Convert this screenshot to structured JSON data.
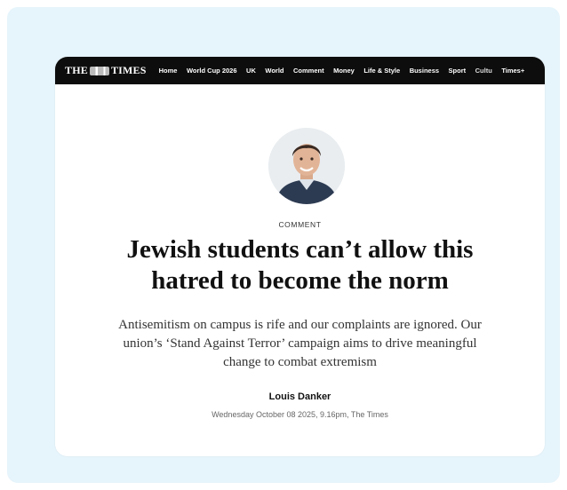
{
  "navbar": {
    "logo_left": "THE",
    "logo_right": "TIMES",
    "items": [
      "Home",
      "World Cup 2026",
      "UK",
      "World",
      "Comment",
      "Money",
      "Life & Style",
      "Business",
      "Sport",
      "Cultu",
      "Times+"
    ]
  },
  "article": {
    "kicker": "COMMENT",
    "headline": "Jewish students can’t allow this hatred to become the norm",
    "standfirst": "Antisemitism on campus is rife and our complaints are ignored. Our union’s ‘Stand Against Terror’ campaign aims to drive meaningful change to combat extremism",
    "author": "Louis Danker",
    "dateline": "Wednesday October 08 2025, 9.16pm, The Times"
  },
  "colors": {
    "outer_background": "#e6f4fb",
    "navbar_background": "#0d0d0d",
    "avatar_background": "#e9edf0",
    "jacket": "#2d3b52"
  }
}
